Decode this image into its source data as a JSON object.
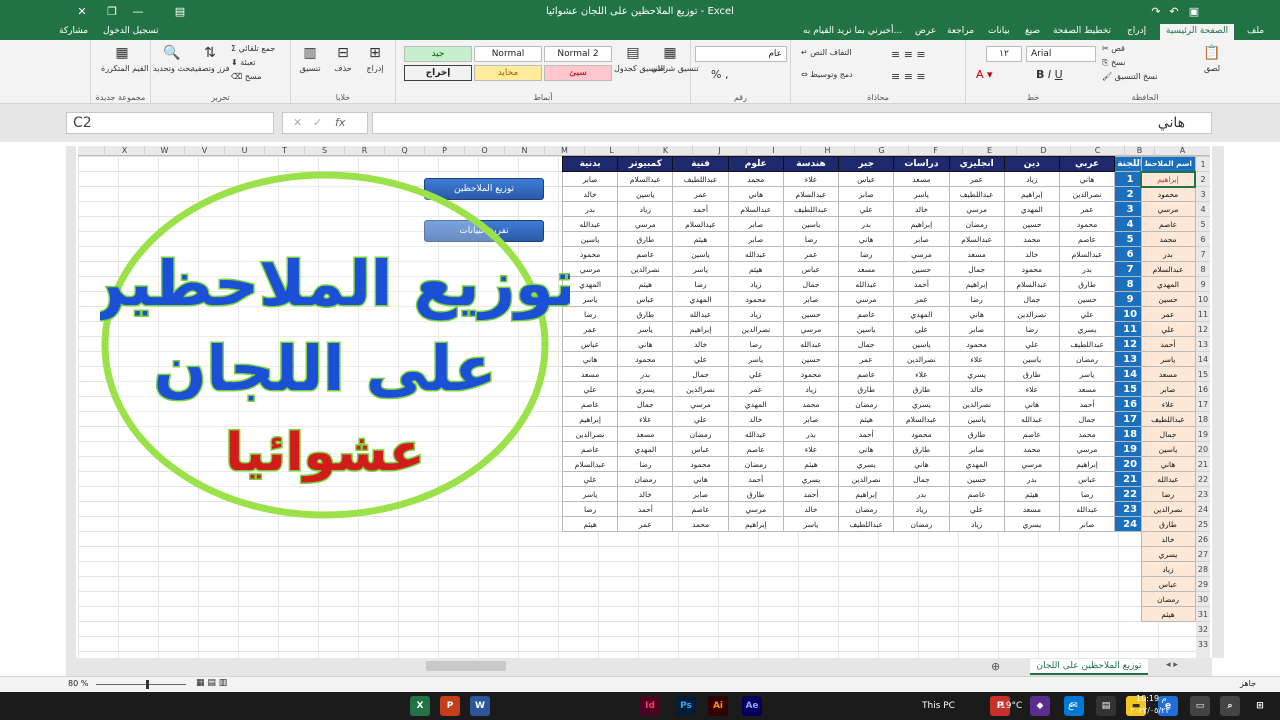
{
  "window": {
    "title": "توزيع الملاحظين على اللجان عشوائيا - Excel",
    "signin": "تسجيل الدخول",
    "share": "مشاركة",
    "tellme": "أخبرني بما تريد القيام به..."
  },
  "tabs": [
    "ملف",
    "الصفحة الرئيسية",
    "إدراج",
    "تخطيط الصفحة",
    "صيغ",
    "بيانات",
    "مراجعة",
    "عرض"
  ],
  "ribbon": {
    "clipboard": {
      "label": "الحافظة",
      "paste": "لصق",
      "cut": "قص",
      "copy": "نسخ",
      "format": "نسخ التنسيق"
    },
    "font": {
      "label": "خط",
      "name": "Arial",
      "size": "١٢"
    },
    "alignment": {
      "label": "محاذاة",
      "wrap": "التفاف النص",
      "merge": "دمج وتوسيط"
    },
    "number": {
      "label": "رقم",
      "format": "عام"
    },
    "styles": {
      "label": "أنماط",
      "conditional": "تنسيق شرطي",
      "as_table": "التنسيق كجدول",
      "cell": [
        "Normal 2",
        "Normal",
        "سيئ",
        "محايد",
        "جيد",
        "إخراج"
      ]
    },
    "cells": {
      "label": "خلايا",
      "insert": "إدراج",
      "delete": "حذف",
      "format": "تنسيق"
    },
    "editing": {
      "label": "تحرير",
      "autosum": "جمع تلقائي",
      "fill": "تعبئة",
      "clear": "مسح",
      "sort": "فرز وتصفية",
      "find": "بحث وتحديد"
    },
    "newgroup": {
      "label": "مجموعة جديدة",
      "mode": "القيم المتكررة"
    }
  },
  "formula": {
    "namebox": "C2",
    "value": "هاني"
  },
  "columns": [
    "A",
    "B",
    "C",
    "D",
    "E",
    "F",
    "G",
    "H",
    "I",
    "J",
    "K",
    "L",
    "M",
    "N",
    "O",
    "P",
    "Q",
    "R",
    "S",
    "T",
    "U",
    "V",
    "W",
    "X"
  ],
  "main_headers": [
    "اللجنة",
    "عربي",
    "دين",
    "انجليزي",
    "دراسات",
    "جبر",
    "هندسة",
    "علوم",
    "فنية",
    "كمبيوتر",
    "بدنية"
  ],
  "main_rows": [
    [
      "1",
      "هاني",
      "زياد",
      "عمر",
      "مسعد",
      "عباس",
      "علاء",
      "محمد",
      "عبداللطيف",
      "عبدالسلام",
      "صابر"
    ],
    [
      "2",
      "نصرالدين",
      "إبراهيم",
      "عبداللطيف",
      "ياسر",
      "صابر",
      "عبدالسلام",
      "هاني",
      "عمر",
      "ياسين",
      "خالد"
    ],
    [
      "3",
      "عمر",
      "المهدي",
      "مرسي",
      "خالد",
      "علي",
      "عبداللطيف",
      "عبدالسلام",
      "أحمد",
      "زياد",
      "بدر"
    ],
    [
      "4",
      "محمود",
      "حسين",
      "رمضان",
      "إبراهيم",
      "بدر",
      "ياسين",
      "صابر",
      "عبدالسلام",
      "مرسي",
      "عبدالله"
    ],
    [
      "5",
      "عاصم",
      "محمد",
      "عبدالسلام",
      "صابر",
      "هاني",
      "رضا",
      "صابر",
      "هيثم",
      "طارق",
      "ياسين"
    ],
    [
      "6",
      "عبدالسلام",
      "خالد",
      "مسعد",
      "مرسي",
      "رضا",
      "عمر",
      "عبدالله",
      "ياسين",
      "عاصم",
      "محمود"
    ],
    [
      "7",
      "بدر",
      "محمود",
      "جمال",
      "حسين",
      "مسعد",
      "عباس",
      "هيثم",
      "ياسر",
      "نصرالدين",
      "مرسي"
    ],
    [
      "8",
      "طارق",
      "عبدالسلام",
      "إبراهيم",
      "أحمد",
      "عبدالله",
      "جمال",
      "زياد",
      "رضا",
      "هيثم",
      "المهدي"
    ],
    [
      "9",
      "حسين",
      "جمال",
      "رضا",
      "عمر",
      "مرسي",
      "صابر",
      "محمود",
      "المهدي",
      "عباس",
      "ياسر"
    ],
    [
      "10",
      "علي",
      "نصرالدين",
      "هاني",
      "المهدي",
      "عاصم",
      "حسين",
      "زياد",
      "عبدالله",
      "طارق",
      "رضا"
    ],
    [
      "11",
      "يسري",
      "رضا",
      "صابر",
      "علي",
      "ياسين",
      "مرسي",
      "نصرالدين",
      "إبراهيم",
      "ياسر",
      "عمر"
    ],
    [
      "12",
      "عبداللطيف",
      "علي",
      "محمود",
      "ياسين",
      "جمال",
      "عبدالله",
      "رضا",
      "خالد",
      "هاني",
      "عباس"
    ],
    [
      "13",
      "رمضان",
      "ياسين",
      "علاء",
      "نصرالدين",
      "عمر",
      "حسين",
      "ياسر",
      "علي",
      "محمود",
      "هاني"
    ],
    [
      "14",
      "ياسر",
      "طارق",
      "يسري",
      "علاء",
      "عاصم",
      "محمود",
      "علي",
      "جمال",
      "بدر",
      "مسعد"
    ],
    [
      "15",
      "مسعد",
      "علاء",
      "خالد",
      "طارق",
      "طارق",
      "زياد",
      "عمر",
      "نصرالدين",
      "يسري",
      "علي"
    ],
    [
      "16",
      "أحمد",
      "هاني",
      "نصرالدين",
      "يسري",
      "رمضان",
      "محمد",
      "المهدي",
      "مرسي",
      "جمال",
      "عاصم"
    ],
    [
      "17",
      "جمال",
      "عبدالله",
      "ياسين",
      "عبدالسلام",
      "هيثم",
      "صابر",
      "خالد",
      "علي",
      "علاء",
      "إبراهيم"
    ],
    [
      "18",
      "محمد",
      "عاصم",
      "طارق",
      "محمود",
      "أحمد",
      "بدر",
      "عبدالله",
      "رمضان",
      "مسعد",
      "نصرالدين"
    ],
    [
      "19",
      "مرسي",
      "محمد",
      "صابر",
      "طارق",
      "هاني",
      "علاء",
      "عاصم",
      "عباس",
      "المهدي",
      "عاصم"
    ],
    [
      "20",
      "إبراهيم",
      "مرسي",
      "المهدي",
      "هاني",
      "يسري",
      "هيثم",
      "رمضان",
      "محمود",
      "رضا",
      "عبدالسلام"
    ],
    [
      "21",
      "عباس",
      "بدر",
      "حسين",
      "جمال",
      "نصرالدين",
      "يسري",
      "أحمد",
      "هاني",
      "رمضان",
      "علي"
    ],
    [
      "22",
      "رضا",
      "هيثم",
      "عاصم",
      "بدر",
      "إبراهيم",
      "أحمد",
      "طارق",
      "صابر",
      "خالد",
      "ياسر"
    ],
    [
      "23",
      "عبدالله",
      "مسعد",
      "علي",
      "زياد",
      "رمضان",
      "خالد",
      "مرسي",
      "عاصم",
      "أحمد",
      "رضا"
    ],
    [
      "24",
      "صابر",
      "يسري",
      "زياد",
      "رمضان",
      "عبداللطيف",
      "ياسر",
      "إبراهيم",
      "محمد",
      "عمر",
      "هيثم"
    ]
  ],
  "observers_header": "اسم الملاحظ",
  "observers": [
    "إبراهيم",
    "محمود",
    "مرسي",
    "عاصم",
    "محمد",
    "بدر",
    "عبدالسلام",
    "المهدي",
    "حسين",
    "عمر",
    "علي",
    "أحمد",
    "ياسر",
    "مسعد",
    "صابر",
    "علاء",
    "عبداللطيف",
    "جمال",
    "ياسين",
    "هاني",
    "عبدالله",
    "رضا",
    "نصرالدين",
    "طارق",
    "خالد",
    "يسري",
    "زياد",
    "عباس",
    "رمضان",
    "هيثم"
  ],
  "buttons": {
    "distribute": "توزيع الملاحظين",
    "clear": "تفريغ البيانات"
  },
  "banner": {
    "line1": "توزيع الملاحظين",
    "line2": "على اللجان",
    "line3": "عشوائيا"
  },
  "sheet_tab": "توزيع الملاحظين على اللجان",
  "status": {
    "ready": "جاهز",
    "zoom": "80 %"
  },
  "taskbar": {
    "thispc": "This PC",
    "temp": "19°C",
    "lang": "ع",
    "time": "10:19 م",
    "date": "٢٠٢٢/٠٥/٢٣"
  }
}
